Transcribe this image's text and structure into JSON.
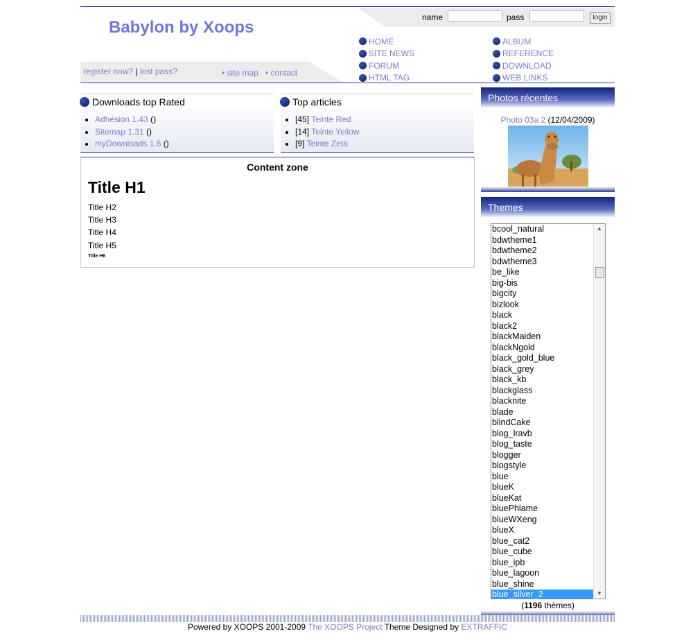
{
  "header": {
    "title": "Babylon by Xoops",
    "login": {
      "name_label": "name",
      "pass_label": "pass",
      "name_value": "",
      "pass_value": "",
      "button": "login"
    },
    "register_link": "register now?",
    "separator": "|",
    "lost_pass_link": "lost pass?",
    "site_map": "• site map",
    "contact": "• contact",
    "nav_left": [
      "HOME",
      "SITE NEWS",
      "FORUM",
      "HTML TAG"
    ],
    "nav_right": [
      "ALBUM",
      "REFERENCE",
      "DOWNLOAD",
      "WEB LINKS"
    ]
  },
  "downloads_block": {
    "title": "Downloads top Rated",
    "items": [
      {
        "name": "Adhésion 1.43",
        "suffix": " ()"
      },
      {
        "name": "Sitemap 1.31",
        "suffix": " ()"
      },
      {
        "name": "myDownloads 1.6",
        "suffix": " ()"
      }
    ]
  },
  "articles_block": {
    "title": "Top articles",
    "items": [
      {
        "count": "[45]",
        "name": "Teinte Red"
      },
      {
        "count": "[14]",
        "name": "Teinte Yellow"
      },
      {
        "count": "[9]",
        "name": "Teinte Zeta"
      }
    ]
  },
  "content": {
    "zone_label": "Content zone",
    "h1": "Title H1",
    "h2": "Title H2",
    "h3": "Title H3",
    "h4": "Title H4",
    "h5": "Title H5",
    "h6": "Title H6"
  },
  "photos": {
    "title": "Photos récentes",
    "caption_link": "Photo 03a 2",
    "caption_date": " (12/04/2009)"
  },
  "themes": {
    "title": "Themes",
    "options": [
      "bcool_natural",
      "bdwtheme1",
      "bdwtheme2",
      "bdwtheme3",
      "be_like",
      "big-bis",
      "bigcity",
      "bizlook",
      "black",
      "black2",
      "blackMaiden",
      "blackNgold",
      "black_gold_blue",
      "black_grey",
      "black_kb",
      "blackglass",
      "blacknite",
      "blade",
      "blindCake",
      "blog_lravb",
      "blog_taste",
      "blogger",
      "blogstyle",
      "blue",
      "blueK",
      "blueKat",
      "bluePhlame",
      "blueWXeng",
      "blueX",
      "blue_cat2",
      "blue_cube",
      "blue_ipb",
      "blue_lagoon",
      "blue_shine",
      "blue_silver_2"
    ],
    "selected": "blue_silver_2",
    "count_open": "(",
    "count": "1196",
    "count_label": " thèmes)"
  },
  "footer": {
    "powered": "Powered by XOOPS 2001-2009 ",
    "project_link": "The XOOPS Project",
    "designed": "  Theme Designed by ",
    "designer_link": "EXTRAFFIC"
  },
  "colors": {
    "accent": "#7b7fc9",
    "dark_blue": "#11237b",
    "selected": "#3399ff"
  }
}
